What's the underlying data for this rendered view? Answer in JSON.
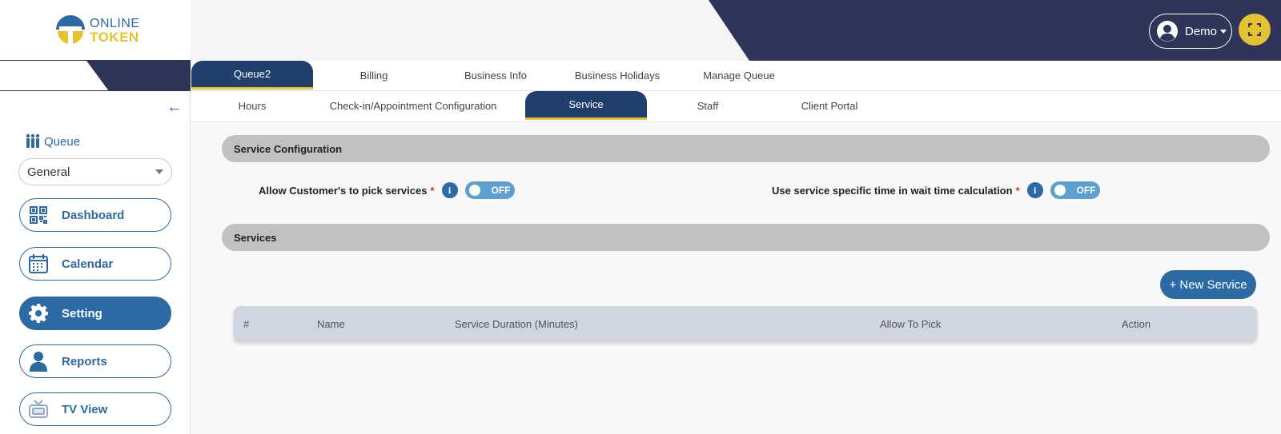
{
  "brand": {
    "line1": "ONLINE",
    "line2": "TOKEN"
  },
  "sidebar": {
    "queue_label": "Queue",
    "queue_select": "General",
    "nav": [
      {
        "label": "Dashboard",
        "icon": "qr-code-icon"
      },
      {
        "label": "Calendar",
        "icon": "calendar-icon"
      },
      {
        "label": "Setting",
        "icon": "gear-icon",
        "active": true
      },
      {
        "label": "Reports",
        "icon": "person-icon"
      },
      {
        "label": "TV View",
        "icon": "tv-icon"
      }
    ]
  },
  "header": {
    "user": "Demo"
  },
  "tabs_row1": [
    "Queue2",
    "Billing",
    "Business Info",
    "Business Holidays",
    "Manage Queue"
  ],
  "tabs_row2": [
    "Hours",
    "Check-in/Appointment Configuration",
    "Service",
    "Staff",
    "Client Portal"
  ],
  "main": {
    "service_config_title": "Service Configuration",
    "option1_label": "Allow Customer's to pick services",
    "option1_state": "OFF",
    "option2_label": "Use service specific time in wait time calculation",
    "option2_state": "OFF",
    "required_mark": "*",
    "info_glyph": "i",
    "services_title": "Services",
    "new_service_label": "+ New Service",
    "table_headers": [
      "#",
      "Name",
      "Service Duration (Minutes)",
      "Allow To Pick",
      "Action"
    ]
  },
  "colors": {
    "navy": "#2f3559",
    "primary": "#2b6aa5",
    "accent_yellow": "#e4c233",
    "active_tab": "#213f6d"
  }
}
